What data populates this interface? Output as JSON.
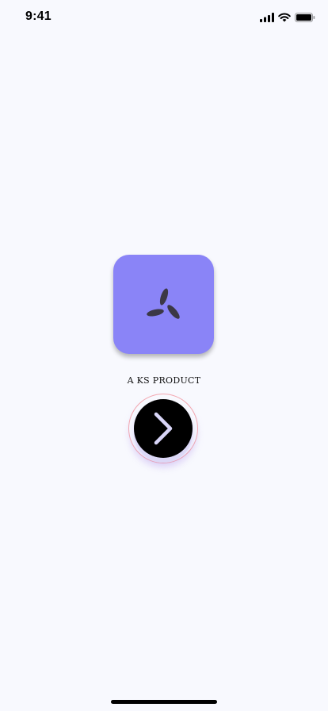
{
  "status_bar": {
    "time": "9:41",
    "icons": [
      "cellular-signal-icon",
      "wifi-icon",
      "battery-icon"
    ]
  },
  "splash": {
    "logo_icon": "three-petal-logo-icon",
    "tagline": "A KS PRODUCT",
    "next_icon": "chevron-right-icon"
  },
  "colors": {
    "background": "#f8f9fe",
    "logo_tile": "#8a84f7",
    "logo_mark": "#3b3846",
    "button": "#000000",
    "chevron": "#d8d5f7",
    "ring": "#f3a7b0"
  }
}
